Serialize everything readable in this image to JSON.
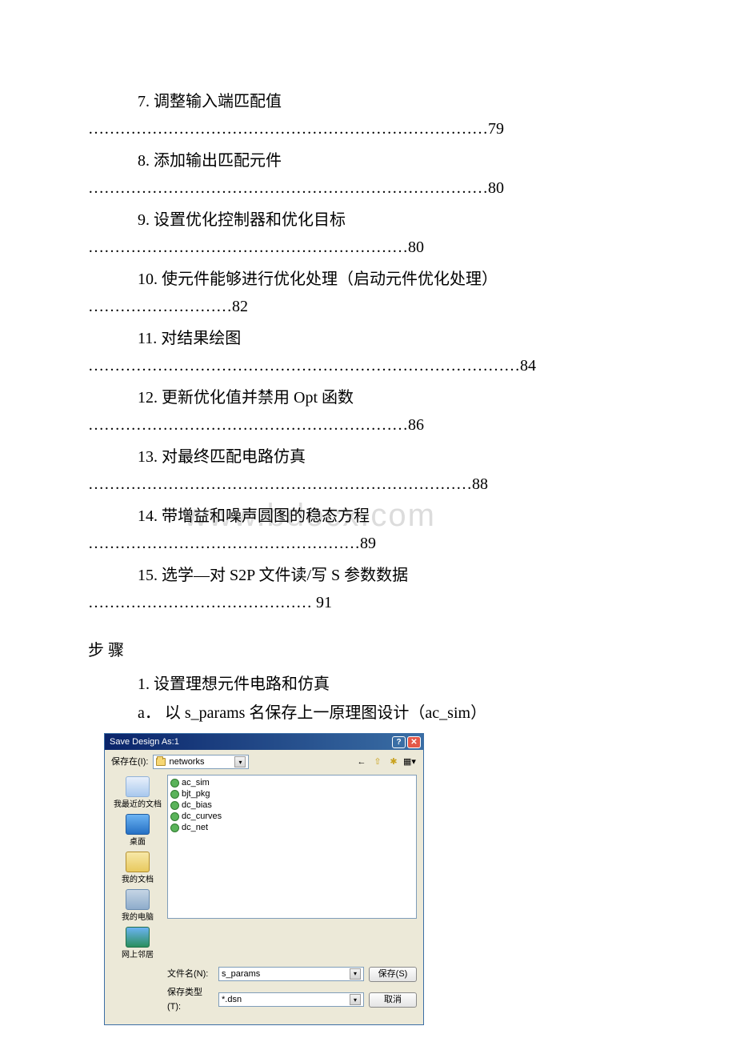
{
  "toc": [
    {
      "title": "7. 调整输入端匹配值",
      "dots": "…………………………………………………………………79"
    },
    {
      "title": "8. 添加输出匹配元件",
      "dots": "…………………………………………………………………80"
    },
    {
      "title": "9. 设置优化控制器和优化目标",
      "dots": "……………………………………………………80"
    },
    {
      "title": "10. 使元件能够进行优化处理（启动元件优化处理）",
      "dots": "………………………82"
    },
    {
      "title": "11. 对结果绘图",
      "dots": "………………………………………………………………………84"
    },
    {
      "title": "12. 更新优化值并禁用 Opt 函数",
      "dots": "……………………………………………………86"
    },
    {
      "title": "13. 对最终匹配电路仿真",
      "dots": "………………………………………………………………88"
    },
    {
      "title": "14. 带增益和噪声圆图的稳态方程",
      "dots": "……………………………………………89"
    },
    {
      "title": "15. 选学—对 S2P 文件读/写 S 参数数据",
      "dots": "…………………………………… 91"
    }
  ],
  "watermark": "www.bdocx.com",
  "section_heading": "步 骤",
  "step1_title": "1. 设置理想元件电路和仿真",
  "step1_sub": "a．  以 s_params 名保存上一原理图设计（ac_sim）",
  "dialog": {
    "title": "Save Design As:1",
    "lookin_label": "保存在(I):",
    "lookin_value": "networks",
    "files": [
      "ac_sim",
      "bjt_pkg",
      "dc_bias",
      "dc_curves",
      "dc_net"
    ],
    "places": [
      {
        "label": "我最近的文档"
      },
      {
        "label": "桌面"
      },
      {
        "label": "我的文档"
      },
      {
        "label": "我的电脑"
      },
      {
        "label": "网上邻居"
      }
    ],
    "filename_label": "文件名(N):",
    "filename_value": "s_params",
    "filetype_label": "保存类型(T):",
    "filetype_value": "*.dsn",
    "save_btn": "保存(S)",
    "cancel_btn": "取消"
  }
}
